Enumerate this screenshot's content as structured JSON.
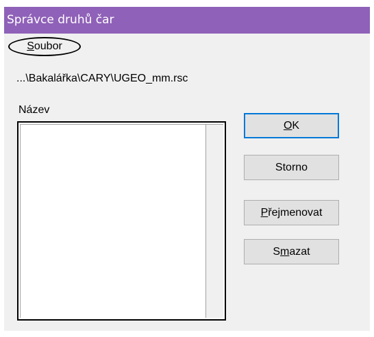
{
  "window": {
    "title": "Správce druhů čar"
  },
  "menu": {
    "file": {
      "accel": "S",
      "rest": "oubor"
    }
  },
  "file_path": "...\\Bakalářka\\CARY\\UGEO_mm.rsc",
  "list": {
    "label": "Název",
    "items": []
  },
  "buttons": {
    "ok": {
      "pre": "",
      "accel": "O",
      "post": "K"
    },
    "cancel": {
      "label": "Storno"
    },
    "rename": {
      "pre": "",
      "accel": "P",
      "post": "řejmenovat"
    },
    "delete": {
      "pre": "S",
      "accel": "m",
      "post": "azat"
    }
  },
  "colors": {
    "titlebar": "#8f61b8",
    "default_button_border": "#0078d7",
    "window_bg": "#f0f0f0"
  }
}
